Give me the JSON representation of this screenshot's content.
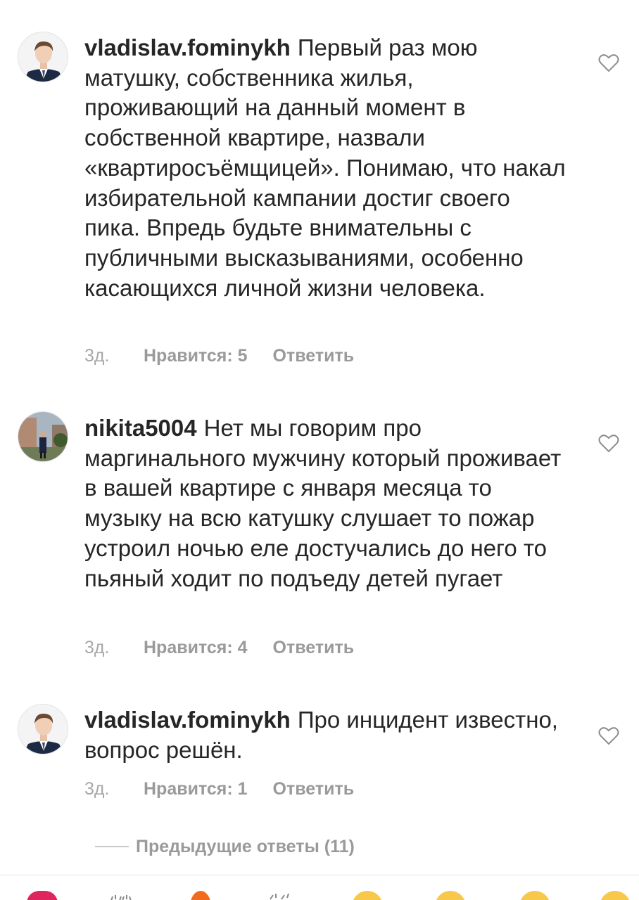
{
  "comments": [
    {
      "username": "vladislav.fominykh",
      "text": "Первый раз мою матушку, собственника жилья, проживающий на данный момент в собственной квартире, назвали «квартиросъёмщицей». Понимаю, что накал избирательной кампании достиг своего пика. Впредь будьте внимательны с публичными высказываниями, особенно касающихся личной жизни человека.",
      "time": "3д.",
      "likes": "Нравится: 5",
      "reply": "Ответить",
      "avatar": "man-in-suit"
    },
    {
      "username": "nikita5004",
      "text": "Нет мы говорим про маргинального мужчину который проживает в вашей квартире с января месяца  то музыку на всю катушку слушает то пожар устроил ночью еле достучались до него то пьяный ходит по подъеду детей пугает",
      "time": "3д.",
      "likes": "Нравится: 4",
      "reply": "Ответить",
      "avatar": "person-outdoors"
    },
    {
      "username": "vladislav.fominykh",
      "text": "Про инцидент известно, вопрос решён.",
      "time": "3д.",
      "likes": "Нравится: 1",
      "reply": "Ответить",
      "avatar": "man-in-suit"
    }
  ],
  "previous_replies_label": "Предыдущие ответы (11)",
  "icons": {
    "like": "heart-outline-icon"
  },
  "colors": {
    "text": "#262626",
    "meta": "#9a9a9a",
    "heart": "#8e8e8e"
  },
  "emoji_bar": [
    "red-heart",
    "raised-hands",
    "fire",
    "clapping-hands",
    "crying-face",
    "heart-eyes-face",
    "surprised-face",
    "laughing-face"
  ]
}
